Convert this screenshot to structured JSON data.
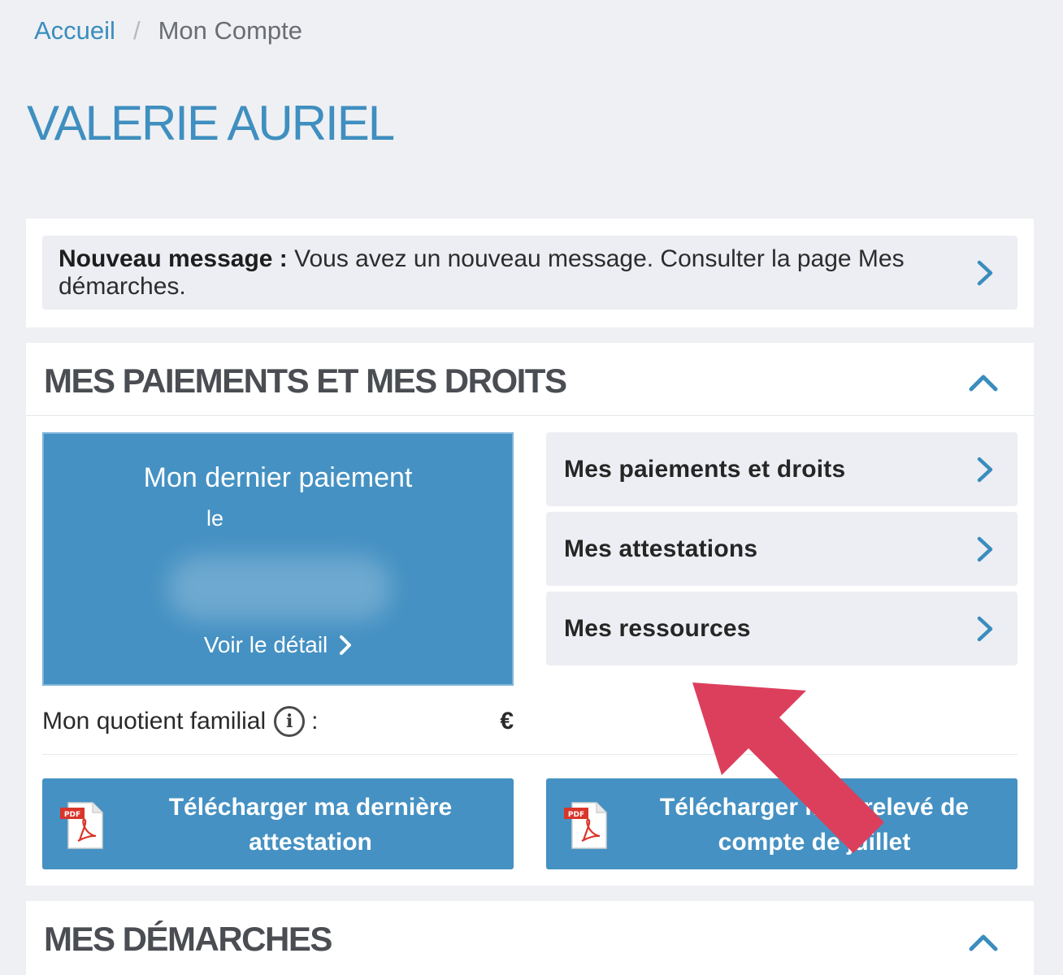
{
  "breadcrumb": {
    "home": "Accueil",
    "separator": "/",
    "current": "Mon Compte"
  },
  "page_title": "VALERIE AURIEL",
  "message": {
    "label": "Nouveau message :",
    "text": " Vous avez un nouveau message. Consulter la page Mes démarches."
  },
  "payments_section": {
    "title": "MES PAIEMENTS ET MES DROITS",
    "last_payment": {
      "title": "Mon dernier paiement",
      "date_prefix": "le",
      "detail_link": "Voir le détail"
    },
    "quotient": {
      "label": "Mon quotient familial",
      "colon": ":",
      "currency": "€"
    },
    "menu": [
      {
        "label": "Mes paiements et droits"
      },
      {
        "label": "Mes attestations"
      },
      {
        "label": "Mes ressources"
      }
    ],
    "downloads": [
      {
        "label": "Télécharger ma dernière attestation"
      },
      {
        "label": "Télécharger mon relevé de compte de juillet"
      }
    ]
  },
  "demarches_section": {
    "title": "MES DÉMARCHES"
  },
  "colors": {
    "primary": "#4591c3",
    "title_blue": "#3f8fc0",
    "arrow": "#dc3f5c",
    "background": "#eff0f3"
  },
  "icons": [
    "chevron-right-icon",
    "caret-up-icon",
    "info-icon",
    "pdf-icon",
    "red-arrow-annotation"
  ]
}
